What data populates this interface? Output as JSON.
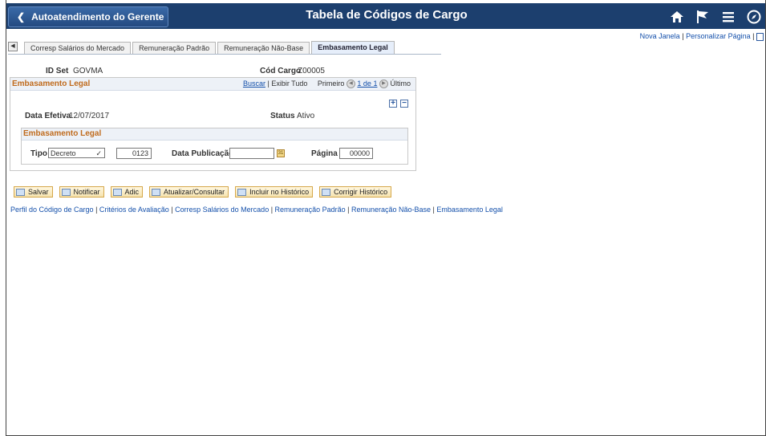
{
  "header": {
    "back_label": "Autoatendimento do Gerente",
    "title": "Tabela de Códigos de Cargo",
    "icons": [
      "home-icon",
      "flag-icon",
      "menu-icon",
      "compass-icon"
    ]
  },
  "top_links": {
    "new_window": "Nova Janela",
    "personalize": "Personalizar Página",
    "sep": "|"
  },
  "tabs": [
    {
      "label": "Corresp Salários do Mercado",
      "active": false
    },
    {
      "label": "Remuneração Padrão",
      "active": false
    },
    {
      "label": "Remuneração Não-Base",
      "active": false
    },
    {
      "label": "Embasamento Legal",
      "active": true
    }
  ],
  "fields": {
    "setid_label": "ID Set",
    "setid_value": "GOVMA",
    "jobcode_label": "Cód Cargo",
    "jobcode_value": "Z00005"
  },
  "section": {
    "title": "Embasamento Legal",
    "find": "Buscar",
    "view_all": "Exibir Tudo",
    "first": "Primeiro",
    "count": "1 de 1",
    "last": "Último",
    "effdt_label": "Data Efetiva",
    "effdt_value": "12/07/2017",
    "status_label": "Status",
    "status_value": "Ativo",
    "add_icon": "+",
    "remove_icon": "−"
  },
  "subsection": {
    "title": "Embasamento Legal",
    "tipo_label": "Tipo",
    "tipo_value": "Decreto",
    "number_value": "0123",
    "pubdate_label": "Data Publicação",
    "pubdate_value": "",
    "page_label": "Página",
    "page_value": "00000"
  },
  "buttons": {
    "save": "Salvar",
    "notify": "Notificar",
    "add": "Adic",
    "update": "Atualizar/Consultar",
    "include": "Incluir no Histórico",
    "correct": "Corrigir Histórico"
  },
  "bottom_links": [
    "Perfil do Código de Cargo",
    "Critérios de Avaliação",
    "Corresp Salários do Mercado",
    "Remuneração Padrão",
    "Remuneração Não-Base",
    "Embasamento Legal"
  ]
}
